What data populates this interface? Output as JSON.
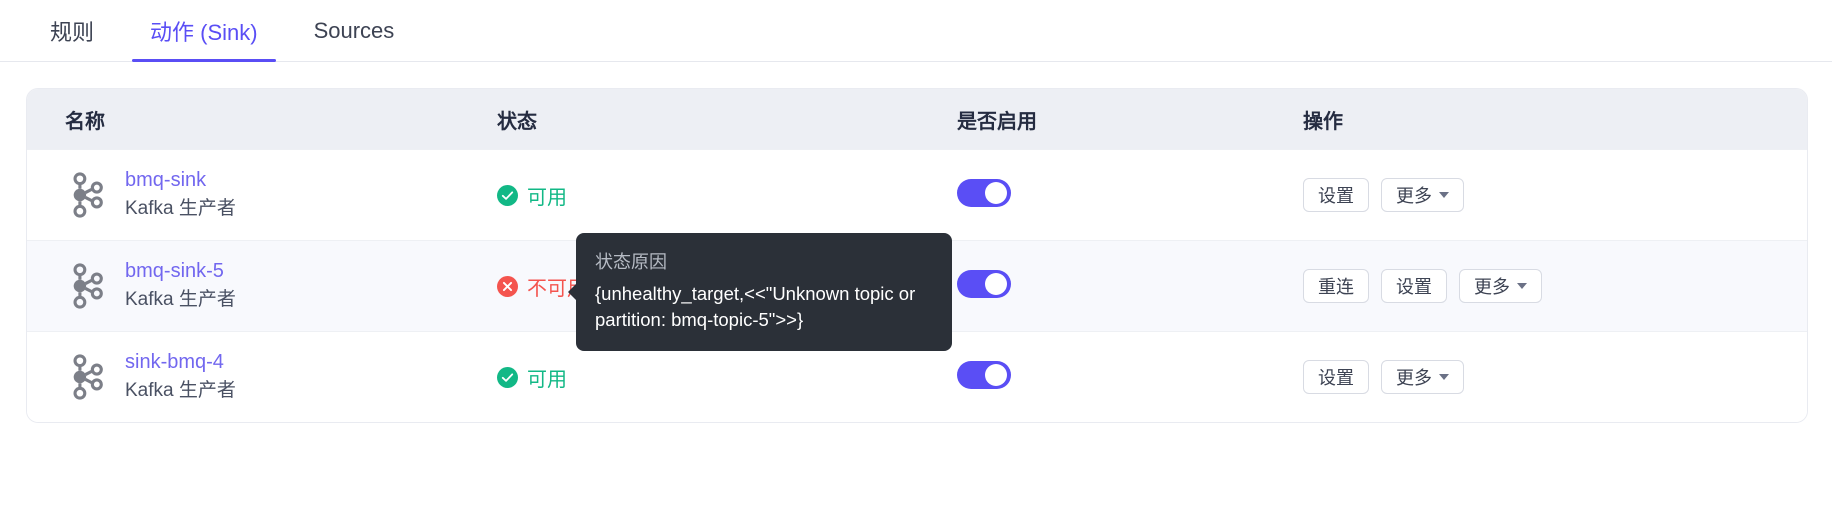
{
  "tabs": [
    {
      "label": "规则",
      "active": false
    },
    {
      "label": "动作 (Sink)",
      "active": true
    },
    {
      "label": "Sources",
      "active": false
    }
  ],
  "table": {
    "headers": {
      "name": "名称",
      "status": "状态",
      "enabled": "是否启用",
      "action": "操作"
    },
    "rows": [
      {
        "name": "bmq-sink",
        "subtitle": "Kafka 生产者",
        "icon": "kafka-icon",
        "status_label": "可用",
        "status_kind": "ok",
        "status_icon": "check-circle-icon",
        "enabled": true,
        "highlight": false,
        "buttons": [
          "设置",
          "更多"
        ]
      },
      {
        "name": "bmq-sink-5",
        "subtitle": "Kafka 生产者",
        "icon": "kafka-icon",
        "status_label": "不可用",
        "status_kind": "bad",
        "status_icon": "error-circle-icon",
        "enabled": true,
        "highlight": true,
        "buttons": [
          "重连",
          "设置",
          "更多"
        ]
      },
      {
        "name": "sink-bmq-4",
        "subtitle": "Kafka 生产者",
        "icon": "kafka-icon",
        "status_label": "可用",
        "status_kind": "ok",
        "status_icon": "check-circle-icon",
        "enabled": true,
        "highlight": false,
        "buttons": [
          "设置",
          "更多"
        ]
      }
    ]
  },
  "tooltip": {
    "title": "状态原因",
    "body": "{unhealthy_target,<<\"Unknown topic or partition: bmq-topic-5\">>}"
  },
  "colors": {
    "accent": "#5a4ef5",
    "link": "#7267ef",
    "success": "#12b886",
    "danger": "#f4544e",
    "header_bg": "#edeff4",
    "tooltip_bg": "#2b3038"
  }
}
